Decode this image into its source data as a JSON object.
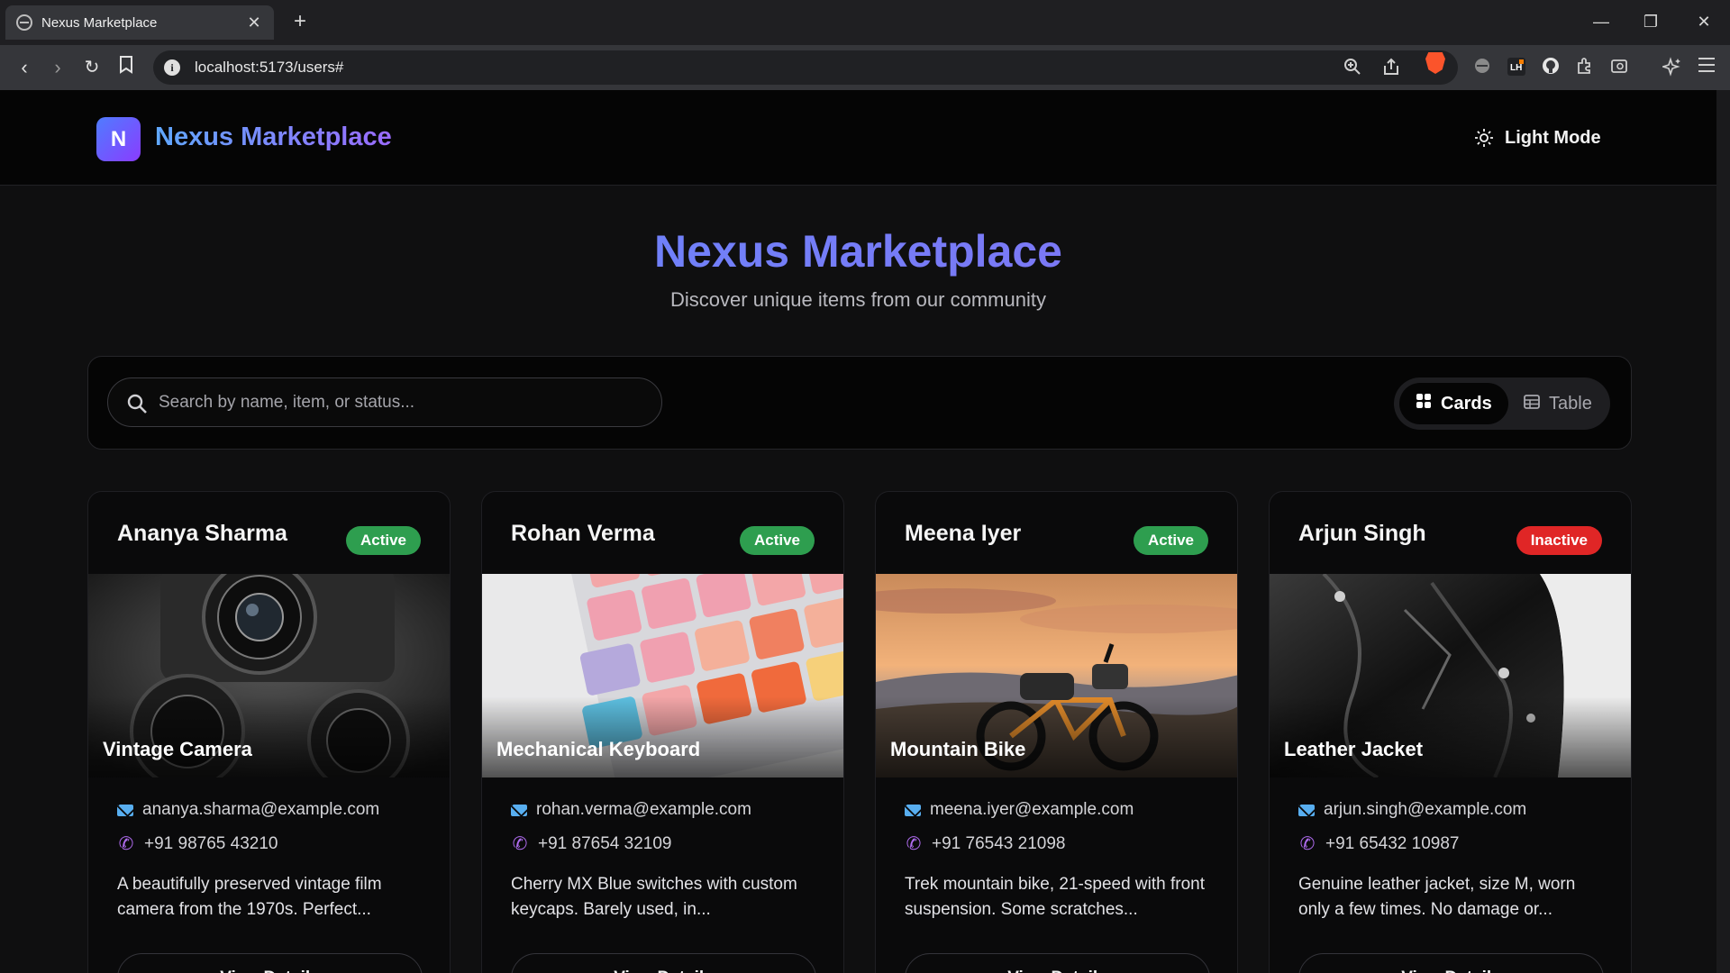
{
  "browser": {
    "tab_title": "Nexus Marketplace",
    "url": "localhost:5173/users#"
  },
  "header": {
    "brand_initial": "N",
    "brand_name": "Nexus Marketplace",
    "mode_toggle_label": "Light Mode"
  },
  "hero": {
    "title": "Nexus Marketplace",
    "subtitle": "Discover unique items from our community"
  },
  "toolbar": {
    "search_placeholder": "Search by name, item, or status...",
    "view_cards_label": "Cards",
    "view_table_label": "Table",
    "active_view": "Cards"
  },
  "colors": {
    "active_badge": "#2e9e4f",
    "inactive_badge": "#e02626",
    "brand_gradient_start": "#4f7cff",
    "brand_gradient_end": "#8a3cff"
  },
  "cards": [
    {
      "name": "Ananya Sharma",
      "status": "Active",
      "item": "Vintage Camera",
      "email": "ananya.sharma@example.com",
      "phone": "+91 98765 43210",
      "description": "A beautifully preserved vintage film camera from the 1970s. Perfect...",
      "button_label": "View Details"
    },
    {
      "name": "Rohan Verma",
      "status": "Active",
      "item": "Mechanical Keyboard",
      "email": "rohan.verma@example.com",
      "phone": "+91 87654 32109",
      "description": "Cherry MX Blue switches with custom keycaps. Barely used, in...",
      "button_label": "View Details"
    },
    {
      "name": "Meena Iyer",
      "status": "Active",
      "item": "Mountain Bike",
      "email": "meena.iyer@example.com",
      "phone": "+91 76543 21098",
      "description": "Trek mountain bike, 21-speed with front suspension. Some scratches...",
      "button_label": "View Details"
    },
    {
      "name": "Arjun Singh",
      "status": "Inactive",
      "item": "Leather Jacket",
      "email": "arjun.singh@example.com",
      "phone": "+91 65432 10987",
      "description": "Genuine leather jacket, size M, worn only a few times. No damage or...",
      "button_label": "View Details"
    }
  ]
}
